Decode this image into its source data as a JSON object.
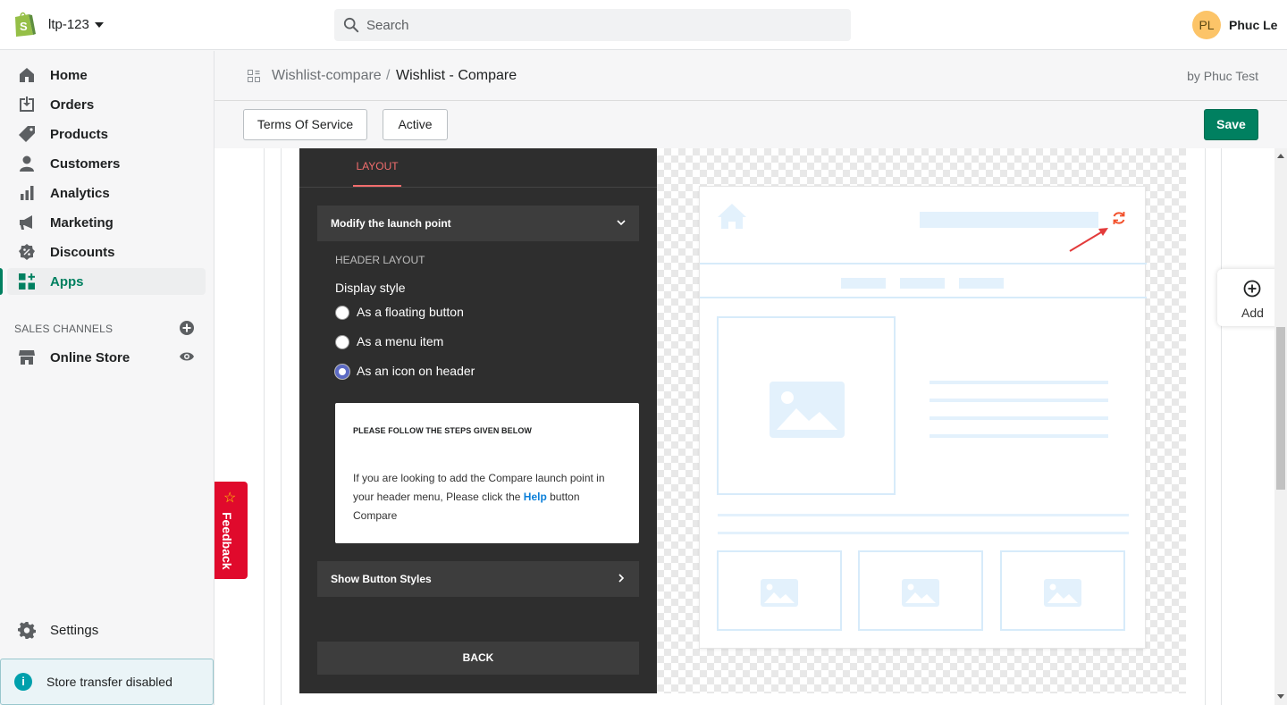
{
  "topbar": {
    "store_name": "ltp-123",
    "search_placeholder": "Search",
    "avatar_initials": "PL",
    "user_name": "Phuc Le"
  },
  "sidebar": {
    "items": [
      {
        "label": "Home",
        "icon": "home-icon"
      },
      {
        "label": "Orders",
        "icon": "orders-icon"
      },
      {
        "label": "Products",
        "icon": "tag-icon"
      },
      {
        "label": "Customers",
        "icon": "person-icon"
      },
      {
        "label": "Analytics",
        "icon": "bar-chart-icon"
      },
      {
        "label": "Marketing",
        "icon": "megaphone-icon"
      },
      {
        "label": "Discounts",
        "icon": "discount-icon"
      },
      {
        "label": "Apps",
        "icon": "apps-icon",
        "active": true
      }
    ],
    "sales_channels_title": "SALES CHANNELS",
    "online_store": "Online Store",
    "settings": "Settings",
    "store_transfer": "Store transfer disabled"
  },
  "feedback": {
    "label": "Feedback"
  },
  "header": {
    "breadcrumb_link": "Wishlist-compare",
    "breadcrumb_sep": "/",
    "breadcrumb_current": "Wishlist - Compare",
    "by_text": "by Phuc Test"
  },
  "actions": {
    "terms": "Terms Of Service",
    "active": "Active",
    "save": "Save"
  },
  "editor": {
    "tab_layout": "LAYOUT",
    "accordion_launch": "Modify the launch point",
    "header_layout_title": "HEADER LAYOUT",
    "display_style_title": "Display style",
    "options": [
      {
        "label": "As a floating button",
        "checked": false
      },
      {
        "label": "As a menu item",
        "checked": false
      },
      {
        "label": "As an icon on header",
        "checked": true
      }
    ],
    "info_title": "PLEASE FOLLOW THE STEPS GIVEN BELOW",
    "info_body_1": "If you are looking to add the Compare launch point in your header menu, Please click the ",
    "info_help": "Help",
    "info_body_2": " button Compare",
    "accordion_styles": "Show Button Styles",
    "back": "BACK"
  },
  "add_widget": {
    "label": "Add"
  },
  "colors": {
    "accent_green": "#008060",
    "tab_red": "#f26d6d",
    "editor_bg": "#2e2e2e",
    "feedback_red": "#e00a2c",
    "preview_blue": "#e3f1fc",
    "compare_icon": "#f2512c"
  }
}
